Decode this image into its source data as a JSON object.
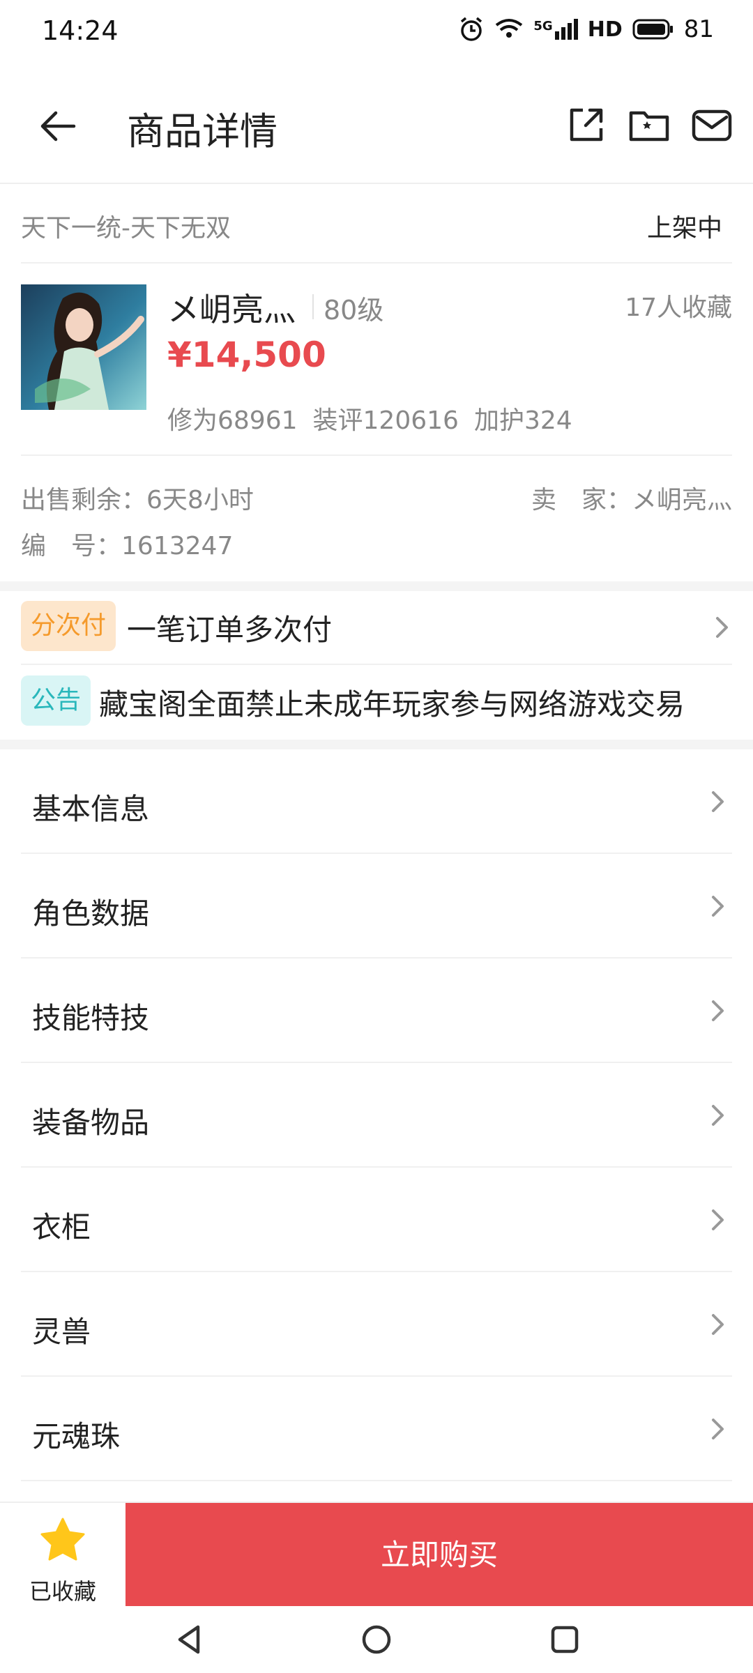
{
  "status_bar": {
    "time": "14:24",
    "network": "5G",
    "hd": "HD",
    "battery": "81"
  },
  "header": {
    "title": "商品详情",
    "icons": [
      "back-arrow-icon",
      "share-icon",
      "favorite-folder-icon",
      "mail-icon"
    ]
  },
  "top": {
    "game": "天下一统-天下无双",
    "listing_status": "上架中"
  },
  "product": {
    "name": "メ岄亮灬",
    "level": "80级",
    "favorites": "17人收藏",
    "price": "¥14,500",
    "stats": [
      "修为68961",
      "装评120616",
      "加护324"
    ]
  },
  "meta": {
    "time_left_label": "出售剩余：",
    "time_left": "6天8小时",
    "seller_label": "卖　家：",
    "seller": "メ岄亮灬",
    "id_label": "编　号：",
    "id": "1613247"
  },
  "notices": [
    {
      "badge": "分次付",
      "text": "一笔订单多次付"
    },
    {
      "badge": "公告",
      "text": "藏宝阁全面禁止未成年玩家参与网络游戏交易"
    }
  ],
  "menu": [
    {
      "label": "基本信息"
    },
    {
      "label": "角色数据"
    },
    {
      "label": "技能特技"
    },
    {
      "label": "装备物品"
    },
    {
      "label": "衣柜"
    },
    {
      "label": "灵兽"
    },
    {
      "label": "元魂珠"
    }
  ],
  "bottom": {
    "fav_label": "已收藏",
    "buy_label": "立即购买"
  },
  "colors": {
    "accent": "#e84a4f",
    "badge_orange": "#f59a2b",
    "badge_cyan": "#29b7bb",
    "star": "#ffc61a"
  }
}
